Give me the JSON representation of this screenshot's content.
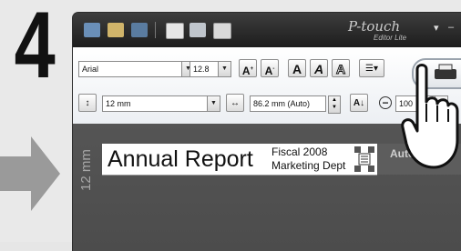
{
  "step": {
    "number": "4"
  },
  "toolbar": {
    "font_name": "Arial",
    "font_size": "12.8",
    "tape_width": "12 mm",
    "label_length": "86.2 mm (Auto)",
    "zoom": "100"
  },
  "app": {
    "brand": "P-touch",
    "edition": "Editor Lite"
  },
  "label": {
    "title": "Annual Report",
    "line1": "Fiscal 2008",
    "line2": "Marketing Dept",
    "tape_width_ruler": "12 mm",
    "length_mode": "Auto"
  },
  "colors": {
    "titlebar": "#2b2b2b",
    "workspace": "#505050",
    "arrow": "#9a9a9a"
  }
}
